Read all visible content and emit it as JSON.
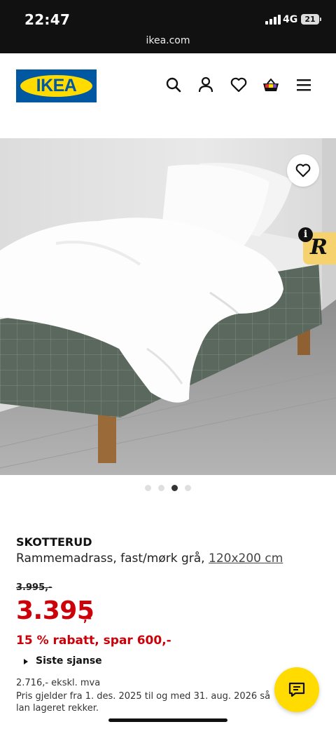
{
  "status": {
    "time": "22:47",
    "network": "4G",
    "battery": "21",
    "url": "ikea.com"
  },
  "header": {
    "logo_text": "IKEA",
    "icons": [
      "search-icon",
      "user-icon",
      "heart-icon",
      "shopping-bag-icon",
      "menu-icon"
    ]
  },
  "gallery": {
    "image_count": 4,
    "active_index": 2
  },
  "product": {
    "name": "SKOTTERUD",
    "description": "Rammemadrass, fast/mørk grå,",
    "size": "120x200 cm",
    "old_price": "3.995,-",
    "price": "3.395",
    "price_suffix": ",-",
    "discount": "15 % rabatt, spar 600,-",
    "badge": "Siste sjanse",
    "ex_vat": "2.716,- ekskl. mva",
    "validity": "Pris gjelder fra 1. des. 2025 til og med 31. aug. 2026 så lan lageret rekker."
  },
  "colors": {
    "ikea_blue": "#0058a3",
    "ikea_yellow": "#ffdb00",
    "sale_red": "#cc0008",
    "mattress_green": "#5f6e62"
  }
}
